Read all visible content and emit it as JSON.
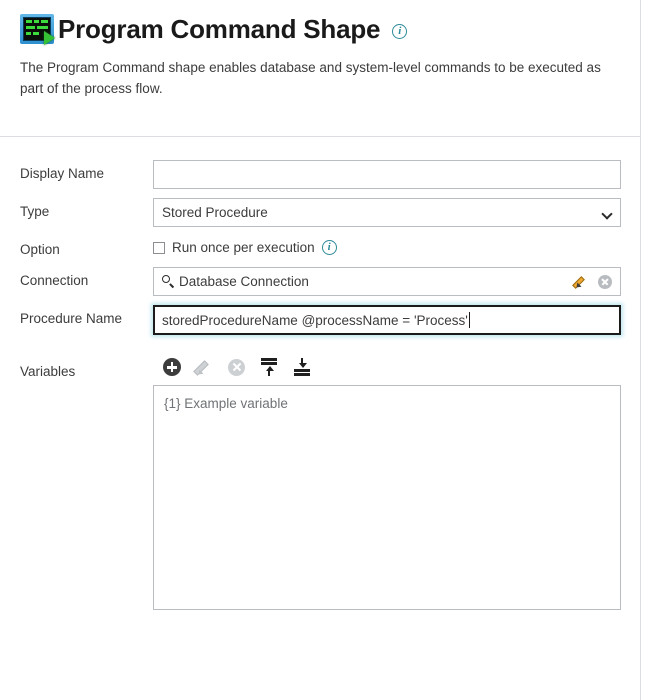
{
  "header": {
    "icon": "program-command-shape-icon",
    "title": "Program Command Shape",
    "info_icon": "info-icon",
    "description": "The Program Command shape enables database and system-level commands to be executed as part of the process flow."
  },
  "form": {
    "display_name": {
      "label": "Display Name",
      "value": "",
      "placeholder": ""
    },
    "type": {
      "label": "Type",
      "value": "Stored Procedure",
      "options": [
        "Stored Procedure"
      ],
      "chevron_icon": "chevron-down-icon"
    },
    "option": {
      "label": "Option",
      "checkbox_label": "Run once per execution",
      "checked": false,
      "info_icon": "info-icon"
    },
    "connection": {
      "label": "Connection",
      "value": "Database Connection",
      "search_icon": "search-icon",
      "edit_icon": "pencil-icon",
      "clear_icon": "clear-circle-icon"
    },
    "procedure_name": {
      "label": "Procedure Name",
      "value": "storedProcedureName @processName = 'Process'",
      "focused": true
    },
    "variables": {
      "label": "Variables",
      "toolbar": [
        {
          "name": "add-variable-button",
          "icon": "plus-circle-icon",
          "enabled": true
        },
        {
          "name": "edit-variable-button",
          "icon": "pencil-icon",
          "enabled": false
        },
        {
          "name": "delete-variable-button",
          "icon": "clear-circle-icon",
          "enabled": false
        },
        {
          "name": "move-to-top-button",
          "icon": "move-to-top-icon",
          "enabled": true
        },
        {
          "name": "move-to-bottom-button",
          "icon": "move-to-bottom-icon",
          "enabled": true
        }
      ],
      "items": [
        "{1} Example variable"
      ]
    }
  },
  "colors": {
    "accent_info": "#2f8a99",
    "border": "#b9bcc0",
    "divider": "#dcdde0",
    "text": "#3c3c3c",
    "muted_text": "#6f7276",
    "focus_glow": "#bfe6ef",
    "pencil": "#f0a830",
    "icon_dark": "#3d3d3d",
    "icon_disabled": "#cdd0d3",
    "terminal_green": "#3ddc3d"
  }
}
